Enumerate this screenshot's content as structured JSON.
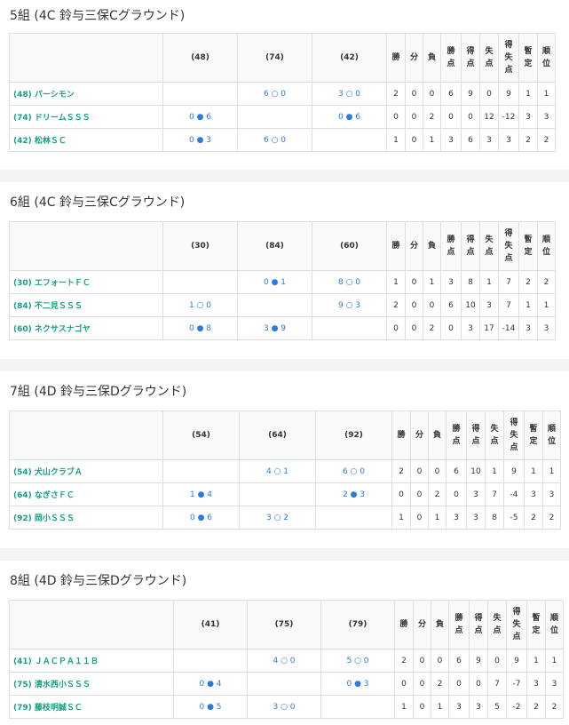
{
  "groups": [
    {
      "title": "5組 (4C 鈴与三保Cグラウンド)",
      "columns": [
        "(48)",
        "(74)",
        "(42)"
      ],
      "stat_headers": [
        "勝",
        "分",
        "負",
        "勝点",
        "得点",
        "失点",
        "得失点",
        "暫定",
        "順位"
      ],
      "rows": [
        {
          "team": "(48) パーシモン",
          "results": [
            "",
            "6 ○ 0",
            "3 ○ 0"
          ],
          "stats": [
            "2",
            "0",
            "0",
            "6",
            "9",
            "0",
            "9",
            "1",
            "1"
          ]
        },
        {
          "team": "(74) ドリームＳＳＳ",
          "results": [
            "0 ● 6",
            "",
            "0 ● 6"
          ],
          "stats": [
            "0",
            "0",
            "2",
            "0",
            "0",
            "12",
            "-12",
            "3",
            "3"
          ]
        },
        {
          "team": "(42) 松林ＳＣ",
          "results": [
            "0 ● 3",
            "6 ○ 0",
            ""
          ],
          "stats": [
            "1",
            "0",
            "1",
            "3",
            "6",
            "3",
            "3",
            "2",
            "2"
          ]
        }
      ]
    },
    {
      "title": "6組 (4C 鈴与三保Cグラウンド)",
      "columns": [
        "(30)",
        "(84)",
        "(60)"
      ],
      "stat_headers": [
        "勝",
        "分",
        "負",
        "勝点",
        "得点",
        "失点",
        "得失点",
        "暫定",
        "順位"
      ],
      "rows": [
        {
          "team": "(30) エフォートＦＣ",
          "results": [
            "",
            "0 ● 1",
            "8 ○ 0"
          ],
          "stats": [
            "1",
            "0",
            "1",
            "3",
            "8",
            "1",
            "7",
            "2",
            "2"
          ]
        },
        {
          "team": "(84) 不二見ＳＳＳ",
          "results": [
            "1 ○ 0",
            "",
            "9 ○ 3"
          ],
          "stats": [
            "2",
            "0",
            "0",
            "6",
            "10",
            "3",
            "7",
            "1",
            "1"
          ]
        },
        {
          "team": "(60) ネクサスナゴヤ",
          "results": [
            "0 ● 8",
            "3 ● 9",
            ""
          ],
          "stats": [
            "0",
            "0",
            "2",
            "0",
            "3",
            "17",
            "-14",
            "3",
            "3"
          ]
        }
      ]
    },
    {
      "title": "7組 (4D 鈴与三保Dグラウンド)",
      "columns": [
        "(54)",
        "(64)",
        "(92)"
      ],
      "stat_headers": [
        "勝",
        "分",
        "負",
        "勝点",
        "得点",
        "失点",
        "得失点",
        "暫定",
        "順位"
      ],
      "rows": [
        {
          "team": "(54) 犬山クラブＡ",
          "results": [
            "",
            "4 ○ 1",
            "6 ○ 0"
          ],
          "stats": [
            "2",
            "0",
            "0",
            "6",
            "10",
            "1",
            "9",
            "1",
            "1"
          ]
        },
        {
          "team": "(64) なぎさＦＣ",
          "results": [
            "1 ● 4",
            "",
            "2 ● 3"
          ],
          "stats": [
            "0",
            "0",
            "2",
            "0",
            "3",
            "7",
            "-4",
            "3",
            "3"
          ]
        },
        {
          "team": "(92) 岡小ＳＳＳ",
          "results": [
            "0 ● 6",
            "3 ○ 2",
            ""
          ],
          "stats": [
            "1",
            "0",
            "1",
            "3",
            "3",
            "8",
            "-5",
            "2",
            "2"
          ]
        }
      ]
    },
    {
      "title": "8組 (4D 鈴与三保Dグラウンド)",
      "columns": [
        "(41)",
        "(75)",
        "(79)"
      ],
      "stat_headers": [
        "勝",
        "分",
        "負",
        "勝点",
        "得点",
        "失点",
        "得失点",
        "暫定",
        "順位"
      ],
      "rows": [
        {
          "team": "(41) ＪＡＣＰＡ１１Ｂ",
          "results": [
            "",
            "4 ○ 0",
            "5 ○ 0"
          ],
          "stats": [
            "2",
            "0",
            "0",
            "6",
            "9",
            "0",
            "9",
            "1",
            "1"
          ]
        },
        {
          "team": "(75) 清水西小ＳＳＳ",
          "results": [
            "0 ● 4",
            "",
            "0 ● 3"
          ],
          "stats": [
            "0",
            "0",
            "2",
            "0",
            "0",
            "7",
            "-7",
            "3",
            "3"
          ]
        },
        {
          "team": "(79) 藤枝明誠ＳＣ",
          "results": [
            "0 ● 5",
            "3 ○ 0",
            ""
          ],
          "stats": [
            "1",
            "0",
            "1",
            "3",
            "3",
            "5",
            "-2",
            "2",
            "2"
          ]
        }
      ]
    }
  ]
}
